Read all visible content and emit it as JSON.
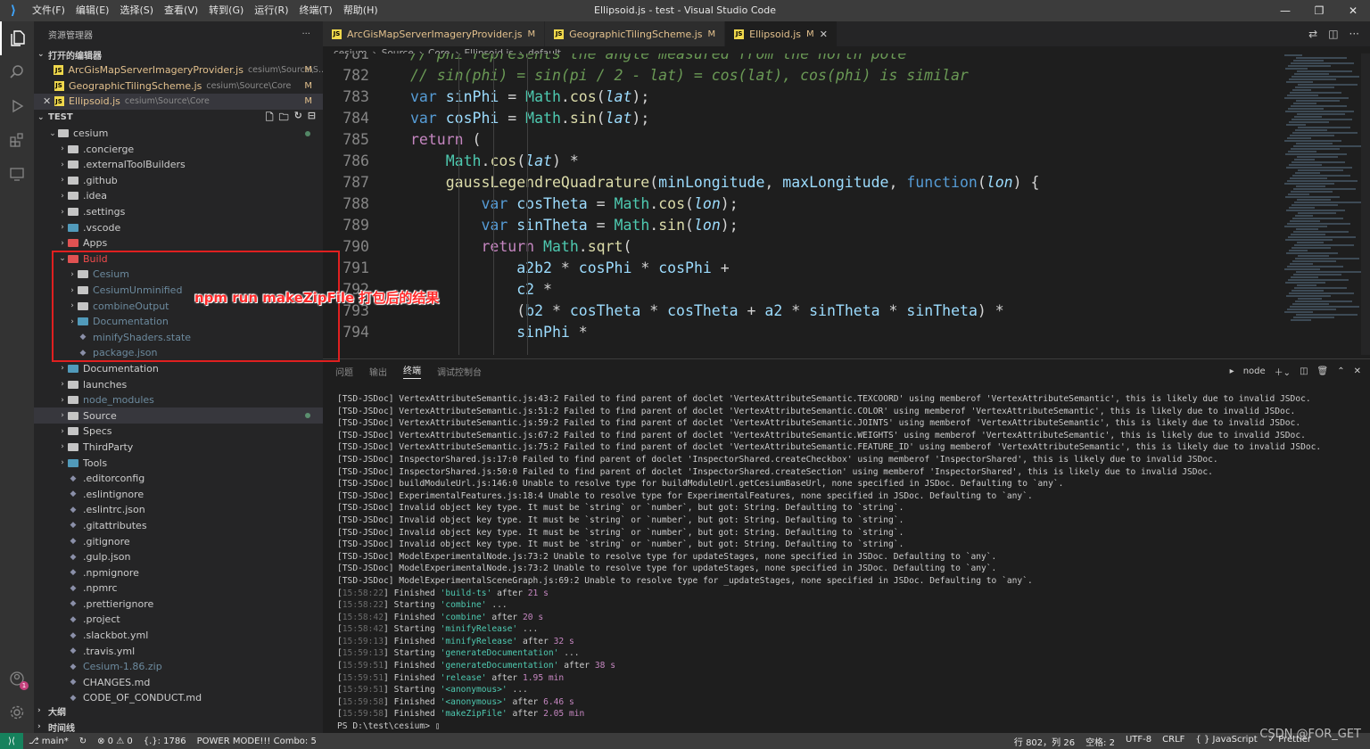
{
  "titlebar": {
    "menu": [
      "文件(F)",
      "编辑(E)",
      "选择(S)",
      "查看(V)",
      "转到(G)",
      "运行(R)",
      "终端(T)",
      "帮助(H)"
    ],
    "title": "Ellipsoid.js - test - Visual Studio Code"
  },
  "sidebar": {
    "header": "资源管理器",
    "open_editors_label": "打开的编辑器",
    "open_editors": [
      {
        "name": "ArcGisMapServerImageryProvider.js",
        "path": "cesium\\Source\\S...",
        "status": "M"
      },
      {
        "name": "GeographicTilingScheme.js",
        "path": "cesium\\Source\\Core",
        "status": "M"
      },
      {
        "name": "Ellipsoid.js",
        "path": "cesium\\Source\\Core",
        "status": "M"
      }
    ],
    "workspace_label": "TEST",
    "tree": [
      {
        "label": "cesium",
        "type": "folder-open",
        "level": 1
      },
      {
        "label": ".concierge",
        "type": "folder",
        "level": 2
      },
      {
        "label": ".externalToolBuilders",
        "type": "folder",
        "level": 2
      },
      {
        "label": ".github",
        "type": "folder",
        "level": 2
      },
      {
        "label": ".idea",
        "type": "folder",
        "level": 2
      },
      {
        "label": ".settings",
        "type": "folder",
        "level": 2
      },
      {
        "label": ".vscode",
        "type": "folder-blue",
        "level": 2
      },
      {
        "label": "Apps",
        "type": "folder-red",
        "level": 2
      },
      {
        "label": "Build",
        "type": "folder-red-open",
        "level": 2
      },
      {
        "label": "Cesium",
        "type": "folder",
        "level": 3
      },
      {
        "label": "CesiumUnminified",
        "type": "folder",
        "level": 3
      },
      {
        "label": "combineOutput",
        "type": "folder",
        "level": 3
      },
      {
        "label": "Documentation",
        "type": "folder-blue",
        "level": 3
      },
      {
        "label": "minifyShaders.state",
        "type": "file",
        "level": 3
      },
      {
        "label": "package.json",
        "type": "file",
        "level": 3
      },
      {
        "label": "Documentation",
        "type": "folder-blue",
        "level": 2
      },
      {
        "label": "launches",
        "type": "folder",
        "level": 2
      },
      {
        "label": "node_modules",
        "type": "folder",
        "level": 2
      },
      {
        "label": "Source",
        "type": "folder",
        "level": 2
      },
      {
        "label": "Specs",
        "type": "folder",
        "level": 2
      },
      {
        "label": "ThirdParty",
        "type": "folder",
        "level": 2
      },
      {
        "label": "Tools",
        "type": "folder-blue",
        "level": 2
      },
      {
        "label": ".editorconfig",
        "type": "file",
        "level": 2
      },
      {
        "label": ".eslintignore",
        "type": "file",
        "level": 2
      },
      {
        "label": ".eslintrc.json",
        "type": "file",
        "level": 2
      },
      {
        "label": ".gitattributes",
        "type": "file",
        "level": 2
      },
      {
        "label": ".gitignore",
        "type": "file",
        "level": 2
      },
      {
        "label": ".gulp.json",
        "type": "file",
        "level": 2
      },
      {
        "label": ".npmignore",
        "type": "file",
        "level": 2
      },
      {
        "label": ".npmrc",
        "type": "file",
        "level": 2
      },
      {
        "label": ".prettierignore",
        "type": "file",
        "level": 2
      },
      {
        "label": ".project",
        "type": "file",
        "level": 2
      },
      {
        "label": ".slackbot.yml",
        "type": "file",
        "level": 2
      },
      {
        "label": ".travis.yml",
        "type": "file",
        "level": 2
      },
      {
        "label": "Cesium-1.86.zip",
        "type": "file",
        "level": 2
      },
      {
        "label": "CHANGES.md",
        "type": "file",
        "level": 2
      },
      {
        "label": "CODE_OF_CONDUCT.md",
        "type": "file",
        "level": 2
      }
    ],
    "outline_label": "大纲",
    "timeline_label": "时间线"
  },
  "tabs": [
    {
      "label": "ArcGisMapServerImageryProvider.js",
      "status": "M"
    },
    {
      "label": "GeographicTilingScheme.js",
      "status": "M"
    },
    {
      "label": "Ellipsoid.js",
      "status": "M"
    }
  ],
  "breadcrumb": [
    "cesium",
    "Source",
    "Core",
    "Ellipsoid.js",
    "default"
  ],
  "code_line_numbers": [
    "781",
    "782",
    "783",
    "784",
    "785",
    "786",
    "787",
    "788",
    "789",
    "790",
    "791",
    "792",
    "793",
    "794"
  ],
  "panel": {
    "tabs": [
      "问题",
      "输出",
      "终端",
      "调试控制台"
    ],
    "active_tab": "终端",
    "shell": "node",
    "lines": [
      "[TSD-JSDoc] VertexAttributeSemantic.js:43:2 Failed to find parent of doclet 'VertexAttributeSemantic.TEXCOORD' using memberof 'VertexAttributeSemantic', this is likely due to invalid JSDoc.",
      "[TSD-JSDoc] VertexAttributeSemantic.js:51:2 Failed to find parent of doclet 'VertexAttributeSemantic.COLOR' using memberof 'VertexAttributeSemantic', this is likely due to invalid JSDoc.",
      "[TSD-JSDoc] VertexAttributeSemantic.js:59:2 Failed to find parent of doclet 'VertexAttributeSemantic.JOINTS' using memberof 'VertexAttributeSemantic', this is likely due to invalid JSDoc.",
      "[TSD-JSDoc] VertexAttributeSemantic.js:67:2 Failed to find parent of doclet 'VertexAttributeSemantic.WEIGHTS' using memberof 'VertexAttributeSemantic', this is likely due to invalid JSDoc.",
      "[TSD-JSDoc] VertexAttributeSemantic.js:75:2 Failed to find parent of doclet 'VertexAttributeSemantic.FEATURE_ID' using memberof 'VertexAttributeSemantic', this is likely due to invalid JSDoc.",
      "[TSD-JSDoc] InspectorShared.js:17:0 Failed to find parent of doclet 'InspectorShared.createCheckbox' using memberof 'InspectorShared', this is likely due to invalid JSDoc.",
      "[TSD-JSDoc] InspectorShared.js:50:0 Failed to find parent of doclet 'InspectorShared.createSection' using memberof 'InspectorShared', this is likely due to invalid JSDoc.",
      "[TSD-JSDoc] buildModuleUrl.js:146:0 Unable to resolve type for buildModuleUrl.getCesiumBaseUrl, none specified in JSDoc. Defaulting to `any`.",
      "[TSD-JSDoc] ExperimentalFeatures.js:18:4 Unable to resolve type for ExperimentalFeatures, none specified in JSDoc. Defaulting to `any`.",
      "[TSD-JSDoc] Invalid object key type. It must be `string` or `number`, but got: String. Defaulting to `string`.",
      "[TSD-JSDoc] Invalid object key type. It must be `string` or `number`, but got: String. Defaulting to `string`.",
      "[TSD-JSDoc] Invalid object key type. It must be `string` or `number`, but got: String. Defaulting to `string`.",
      "[TSD-JSDoc] Invalid object key type. It must be `string` or `number`, but got: String. Defaulting to `string`.",
      "[TSD-JSDoc] ModelExperimentalNode.js:73:2 Unable to resolve type for updateStages, none specified in JSDoc. Defaulting to `any`.",
      "[TSD-JSDoc] ModelExperimentalNode.js:73:2 Unable to resolve type for updateStages, none specified in JSDoc. Defaulting to `any`.",
      "[TSD-JSDoc] ModelExperimentalSceneGraph.js:69:2 Unable to resolve type for _updateStages, none specified in JSDoc. Defaulting to `any`."
    ],
    "task_lines": [
      {
        "time": "15:58:22",
        "verb": "Finished",
        "task": "'build-ts'",
        "after": "after",
        "dur": "21 s"
      },
      {
        "time": "15:58:22",
        "verb": "Starting",
        "task": "'combine'",
        "after": "...",
        "dur": ""
      },
      {
        "time": "15:58:42",
        "verb": "Finished",
        "task": "'combine'",
        "after": "after",
        "dur": "20 s"
      },
      {
        "time": "15:58:42",
        "verb": "Starting",
        "task": "'minifyRelease'",
        "after": "...",
        "dur": ""
      },
      {
        "time": "15:59:13",
        "verb": "Finished",
        "task": "'minifyRelease'",
        "after": "after",
        "dur": "32 s"
      },
      {
        "time": "15:59:13",
        "verb": "Starting",
        "task": "'generateDocumentation'",
        "after": "...",
        "dur": ""
      },
      {
        "time": "15:59:51",
        "verb": "Finished",
        "task": "'generateDocumentation'",
        "after": "after",
        "dur": "38 s"
      },
      {
        "time": "15:59:51",
        "verb": "Finished",
        "task": "'release'",
        "after": "after",
        "dur": "1.95 min"
      },
      {
        "time": "15:59:51",
        "verb": "Starting",
        "task": "'<anonymous>'",
        "after": "...",
        "dur": ""
      },
      {
        "time": "15:59:58",
        "verb": "Finished",
        "task": "'<anonymous>'",
        "after": "after",
        "dur": "6.46 s"
      },
      {
        "time": "15:59:58",
        "verb": "Finished",
        "task": "'makeZipFile'",
        "after": "after",
        "dur": "2.05 min"
      }
    ],
    "prompt": "PS D:\\test\\cesium> "
  },
  "statusbar": {
    "branch": "main*",
    "errors": "0",
    "warnings": "0",
    "selection": "{.}: 1786",
    "power_mode": "POWER MODE!!! Combo: 5",
    "position": "行 802，列 26",
    "spaces": "空格: 2",
    "encoding": "UTF-8",
    "eol": "CRLF",
    "language": "JavaScript",
    "formatter": "Prettier"
  },
  "annotation": "npm run makeZipFile 打包后的结果",
  "watermark": "CSDN @FOR_GET"
}
